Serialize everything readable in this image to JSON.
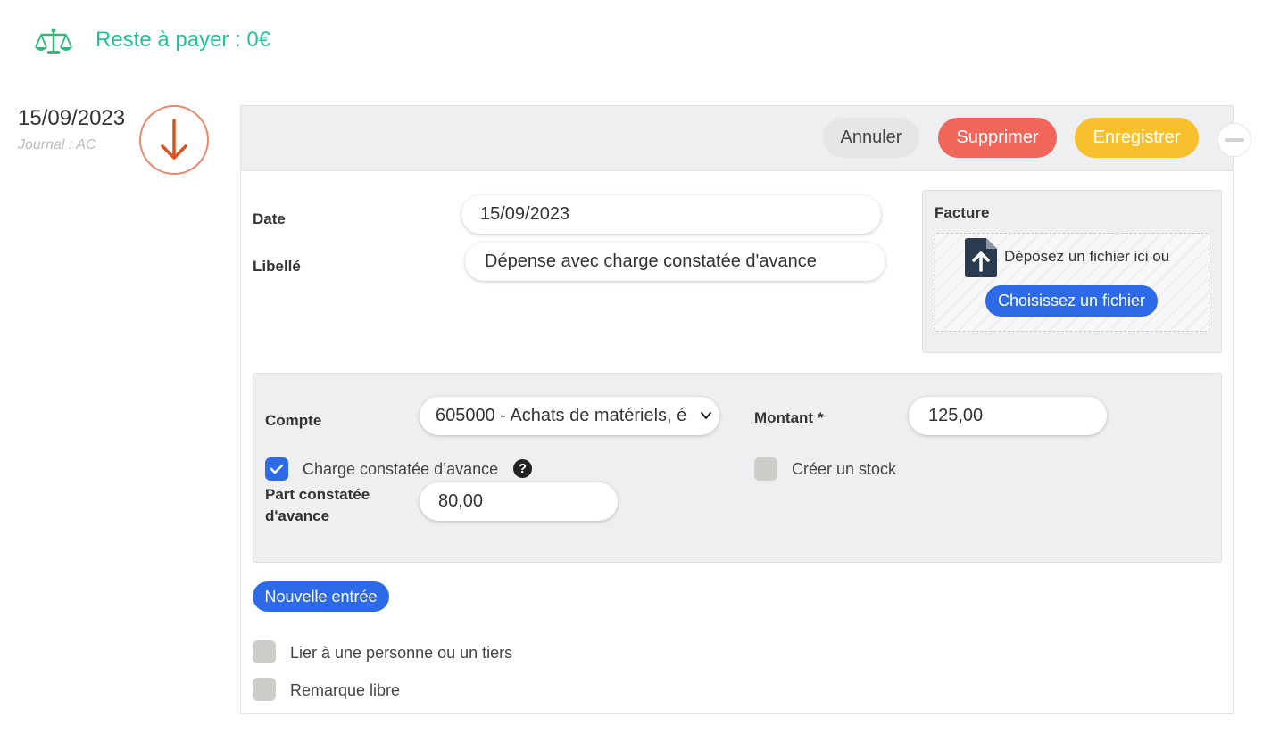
{
  "summary": {
    "balance_text": "Reste à payer : 0€",
    "balance_color": "#22c29a"
  },
  "entry": {
    "date": "15/09/2023",
    "journal": "Journal : AC",
    "direction_icon": "arrow-down-icon",
    "accent": "#d9531e"
  },
  "toolbar": {
    "cancel_label": "Annuler",
    "delete_label": "Supprimer",
    "save_label": "Enregistrer",
    "colors": {
      "delete": "#f2655a",
      "save": "#f6c12c"
    }
  },
  "form": {
    "date_label": "Date",
    "date_value": "15/09/2023",
    "libelle_label": "Libellé",
    "libelle_value": "Dépense avec charge constatée d'avance"
  },
  "facture": {
    "title": "Facture",
    "drop_text": "Déposez un fichier ici ou",
    "choose_label": "Choisissez un fichier"
  },
  "line": {
    "compte_label": "Compte",
    "compte_value": "605000 - Achats de matériels, é",
    "montant_label": "Montant *",
    "montant_value": "125,00",
    "charge_label": "Charge constatée d’avance",
    "charge_checked": true,
    "stock_label": "Créer un stock",
    "stock_checked": false,
    "part_label_line1": "Part constatée",
    "part_label_line2": "d'avance",
    "part_value": "80,00"
  },
  "actions": {
    "new_entry_label": "Nouvelle entrée"
  },
  "options": {
    "link_label": "Lier à une personne ou un tiers",
    "remark_label": "Remarque libre"
  },
  "theme": {
    "primary_blue": "#2d6ae8",
    "panel_gray": "#eeeff0"
  }
}
